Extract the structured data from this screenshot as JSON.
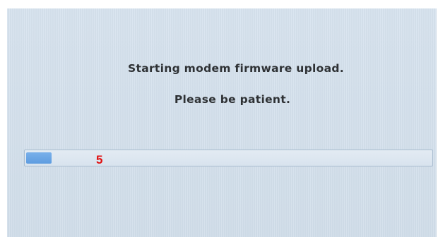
{
  "status": {
    "line1": "Starting modem firmware upload.",
    "line2": "Please be patient."
  },
  "progress": {
    "fraction": 0.063,
    "fill_color": "#6aa6e6"
  },
  "annotation": {
    "step_number": "5",
    "color": "#e01010"
  }
}
